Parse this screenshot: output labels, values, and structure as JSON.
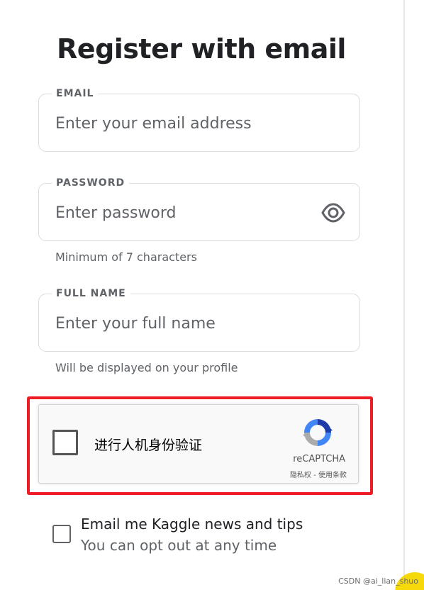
{
  "page": {
    "title": "Register with email"
  },
  "form": {
    "email": {
      "label": "EMAIL",
      "value": "",
      "placeholder": "Enter your email address"
    },
    "password": {
      "label": "PASSWORD",
      "value": "",
      "placeholder": "Enter password",
      "helper": "Minimum of 7 characters",
      "toggle_icon": "eye-icon"
    },
    "full_name": {
      "label": "FULL NAME",
      "value": "",
      "placeholder": "Enter your full name",
      "helper": "Will be displayed on your profile"
    }
  },
  "recaptcha": {
    "label": "进行人机身份验证",
    "brand": "reCAPTCHA",
    "privacy_link": "隐私权",
    "separator": " - ",
    "terms_link": "使用条款",
    "logo_icon": "recaptcha-logo-icon",
    "checked": false,
    "highlight_color": "#ee1c24"
  },
  "newsletter": {
    "title": "Email me Kaggle news and tips",
    "subtitle": "You can opt out at any time",
    "checked": false
  },
  "watermark": "CSDN @ai_lian_shuo",
  "colors": {
    "text_primary": "#202124",
    "text_secondary": "#5f6368",
    "border": "#dadce0",
    "accent_yellow": "#f5d90a"
  }
}
